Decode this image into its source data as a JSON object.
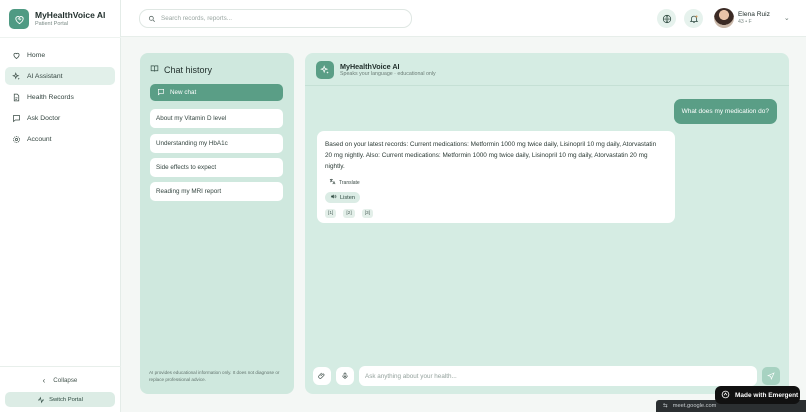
{
  "app": {
    "title": "MyHealthVoice AI",
    "subtitle": "Patient Portal"
  },
  "sidebar": {
    "items": [
      {
        "label": "Home",
        "icon": "heart-icon",
        "active": false
      },
      {
        "label": "AI Assistant",
        "icon": "sparkles-icon",
        "active": true
      },
      {
        "label": "Health Records",
        "icon": "file-icon",
        "active": false
      },
      {
        "label": "Ask Doctor",
        "icon": "chat-icon",
        "active": false
      },
      {
        "label": "Account",
        "icon": "gear-icon",
        "active": false
      }
    ],
    "collapse_label": "Collapse",
    "switch_label": "Switch Portal"
  },
  "header": {
    "search_placeholder": "Search records, reports...",
    "user": {
      "name": "Elena Ruiz",
      "meta": "43 • F"
    }
  },
  "history": {
    "title": "Chat history",
    "new_chat_label": "New chat",
    "items": [
      "About my Vitamin D level",
      "Understanding my HbA1c",
      "Side effects to expect",
      "Reading my MRI report"
    ],
    "disclaimer": "AI provides educational information only. It does not diagnose or replace professional advice."
  },
  "chat": {
    "bot_name": "MyHealthVoice AI",
    "bot_sub": "Speaks your language · educational only",
    "user_message": "What does my medication do?",
    "bot_message": "Based on your latest records: Current medications: Metformin 1000 mg twice daily, Lisinopril 10 mg daily, Atorvastatin 20 mg nightly. Also: Current medications: Metformin 1000 mg twice daily, Lisinopril 10 mg daily, Atorvastatin 20 mg nightly.",
    "translate_label": "Translate",
    "listen_label": "Listen",
    "refs": [
      "[1]",
      "[2]",
      "[3]"
    ],
    "input_placeholder": "Ask anything about your health..."
  },
  "badges": {
    "made_with": "Made with Emergent",
    "meet": "meet.google.com"
  },
  "colors": {
    "accent": "#5a9e86",
    "panel": "#d5ece3",
    "history_panel": "#cfe8de"
  }
}
